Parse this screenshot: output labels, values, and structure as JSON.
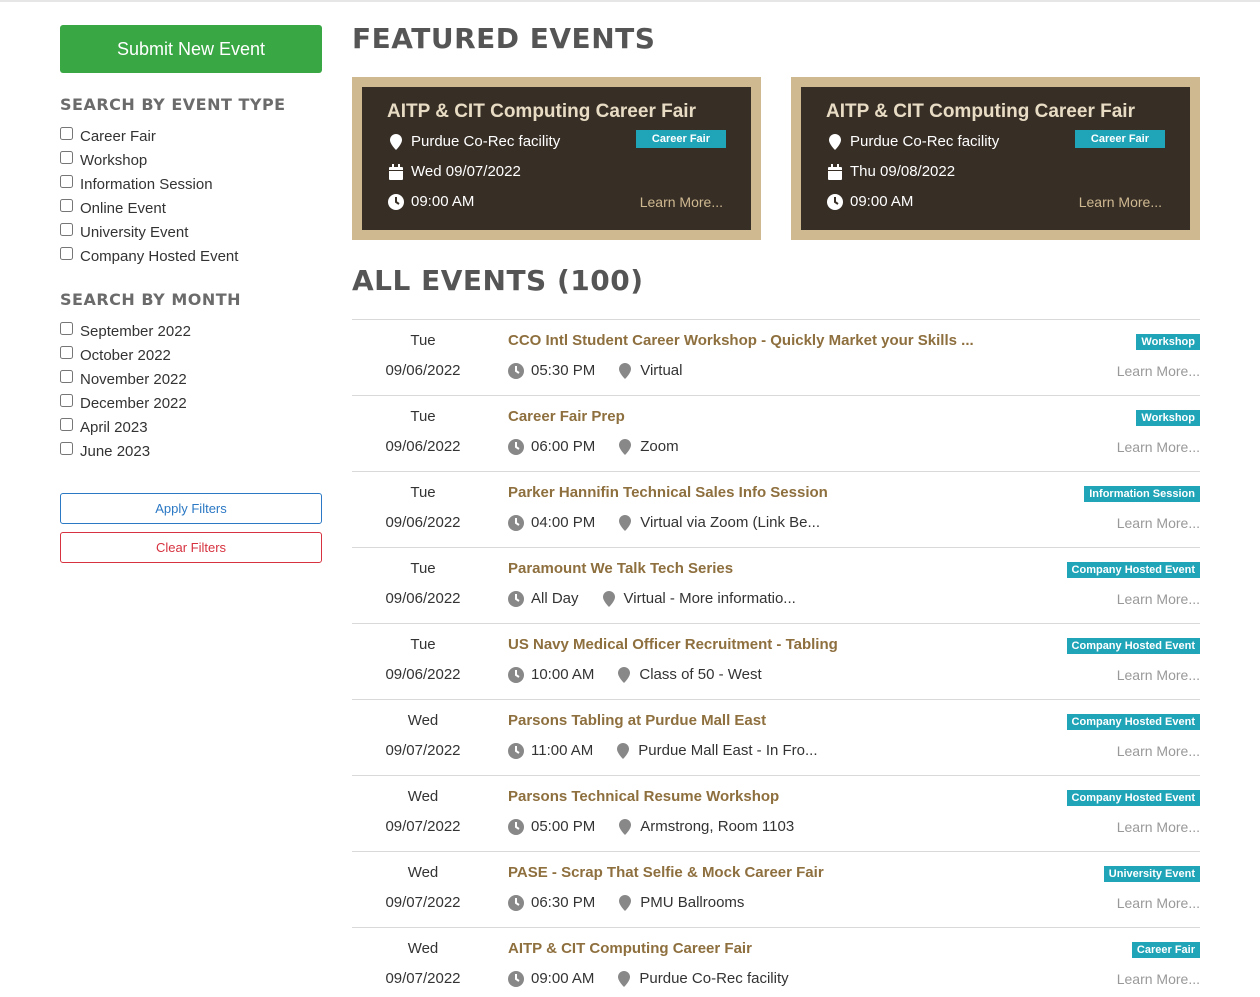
{
  "sidebar": {
    "submit_label": "Submit New Event",
    "event_type_heading": "SEARCH BY EVENT TYPE",
    "event_types": [
      {
        "label": "Career Fair"
      },
      {
        "label": "Workshop"
      },
      {
        "label": "Information Session"
      },
      {
        "label": "Online Event"
      },
      {
        "label": "University Event"
      },
      {
        "label": "Company Hosted Event"
      }
    ],
    "month_heading": "SEARCH BY MONTH",
    "months": [
      {
        "label": "September 2022"
      },
      {
        "label": "October 2022"
      },
      {
        "label": "November 2022"
      },
      {
        "label": "December 2022"
      },
      {
        "label": "April 2023"
      },
      {
        "label": "June 2023"
      }
    ],
    "apply_label": "Apply Filters",
    "clear_label": "Clear Filters"
  },
  "featured": {
    "title": "FEATURED EVENTS",
    "cards": [
      {
        "title": "AITP & CIT Computing Career Fair",
        "location": "Purdue Co-Rec facility",
        "date": "Wed 09/07/2022",
        "time": "09:00 AM",
        "badge": "Career Fair",
        "learn": "Learn More..."
      },
      {
        "title": "AITP & CIT Computing Career Fair",
        "location": "Purdue Co-Rec facility",
        "date": "Thu 09/08/2022",
        "time": "09:00 AM",
        "badge": "Career Fair",
        "learn": "Learn More..."
      }
    ]
  },
  "all_events": {
    "title": "ALL EVENTS (100)",
    "events": [
      {
        "day": "Tue",
        "date": "09/06/2022",
        "title": "CCO Intl Student Career Workshop - Quickly Market your Skills ...",
        "time": "05:30 PM",
        "location": "Virtual",
        "badge": "Workshop",
        "learn": "Learn More..."
      },
      {
        "day": "Tue",
        "date": "09/06/2022",
        "title": "Career Fair Prep",
        "time": "06:00 PM",
        "location": "Zoom",
        "badge": "Workshop",
        "learn": "Learn More..."
      },
      {
        "day": "Tue",
        "date": "09/06/2022",
        "title": "Parker Hannifin Technical Sales Info Session",
        "time": "04:00 PM",
        "location": "Virtual via Zoom (Link Be...",
        "badge": "Information Session",
        "learn": "Learn More..."
      },
      {
        "day": "Tue",
        "date": "09/06/2022",
        "title": "Paramount We Talk Tech Series",
        "time": "All Day",
        "location": "Virtual - More informatio...",
        "badge": "Company Hosted Event",
        "learn": "Learn More..."
      },
      {
        "day": "Tue",
        "date": "09/06/2022",
        "title": "US Navy Medical Officer Recruitment - Tabling",
        "time": "10:00 AM",
        "location": "Class of 50 - West",
        "badge": "Company Hosted Event",
        "learn": "Learn More..."
      },
      {
        "day": "Wed",
        "date": "09/07/2022",
        "title": "Parsons Tabling at Purdue Mall East",
        "time": "11:00 AM",
        "location": "Purdue Mall East - In Fro...",
        "badge": "Company Hosted Event",
        "learn": "Learn More..."
      },
      {
        "day": "Wed",
        "date": "09/07/2022",
        "title": "Parsons Technical Resume Workshop",
        "time": "05:00 PM",
        "location": "Armstrong, Room 1103",
        "badge": "Company Hosted Event",
        "learn": "Learn More..."
      },
      {
        "day": "Wed",
        "date": "09/07/2022",
        "title": "PASE - Scrap That Selfie & Mock Career Fair",
        "time": "06:30 PM",
        "location": "PMU Ballrooms",
        "badge": "University Event",
        "learn": "Learn More..."
      },
      {
        "day": "Wed",
        "date": "09/07/2022",
        "title": "AITP & CIT Computing Career Fair",
        "time": "09:00 AM",
        "location": "Purdue Co-Rec facility",
        "badge": "Career Fair",
        "learn": "Learn More..."
      }
    ]
  },
  "colors": {
    "accent_green": "#3aa745",
    "badge_teal": "#20a4b8",
    "gold": "#cfb991",
    "card_dark": "#372e26",
    "event_title": "#8e6f3e",
    "apply_blue": "#2b78c4",
    "clear_red": "#d6323f"
  },
  "icons": [
    "map-marker-icon",
    "calendar-icon",
    "clock-icon"
  ]
}
